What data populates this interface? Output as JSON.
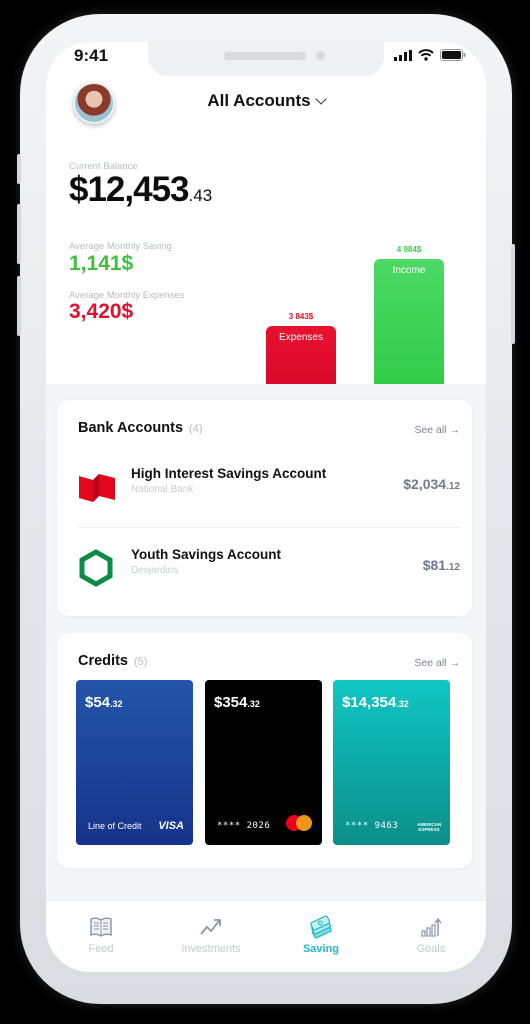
{
  "status_bar": {
    "time": "9:41"
  },
  "header": {
    "title": "All Accounts",
    "dropdown_icon": "chevron-down-icon"
  },
  "summary": {
    "balance_label": "Current Balance",
    "balance_whole": "$12,453",
    "balance_cents": ".43",
    "saving_label": "Average Monthly Saving",
    "saving_value": "1,141$",
    "expenses_label": "Average Monthly Expenses",
    "expenses_value": "3,420$"
  },
  "chart_data": {
    "type": "bar",
    "categories": [
      "Expenses",
      "Income"
    ],
    "values": [
      3843,
      4984
    ],
    "value_labels": [
      "3 843$",
      "4 984$"
    ],
    "colors": [
      "#e0102e",
      "#3fd04f"
    ],
    "title": "",
    "xlabel": "",
    "ylabel": ""
  },
  "bank_accounts": {
    "title": "Bank Accounts",
    "count": "(4)",
    "see_all": "See all",
    "items": [
      {
        "name": "High Interest Savings Account",
        "bank": "National Bank",
        "amount": "$2,034",
        "cents": ".12",
        "logo": "national-bank-logo"
      },
      {
        "name": "Youth Savings Account",
        "bank": "Desjardins",
        "amount": "$81",
        "cents": ".12",
        "logo": "desjardins-logo"
      }
    ]
  },
  "credits": {
    "title": "Credits",
    "count": "(5)",
    "see_all": "See all",
    "cards": [
      {
        "amount": "$54",
        "cents": ".32",
        "bottom_text": "Line of Credit",
        "brand": "VISA",
        "bg": "#1c3d91"
      },
      {
        "amount": "$354",
        "cents": ".32",
        "bottom_text": "**** 2026",
        "brand": "mastercard",
        "bg": "#000000"
      },
      {
        "amount": "$14,354",
        "cents": ".32",
        "bottom_text": "**** 9463",
        "brand": "AMERICAN EXPRESS",
        "bg": "#0fa9a6"
      }
    ]
  },
  "tabbar": {
    "active": "Saving",
    "items": [
      {
        "label": "Feed",
        "icon": "book-icon"
      },
      {
        "label": "Investments",
        "icon": "trend-up-icon"
      },
      {
        "label": "Saving",
        "icon": "money-stack-icon"
      },
      {
        "label": "Goals",
        "icon": "goal-chart-icon"
      }
    ]
  },
  "colors": {
    "accent": "#22b8c4",
    "saving_green": "#3fbf3f",
    "expense_red": "#e0102e"
  }
}
